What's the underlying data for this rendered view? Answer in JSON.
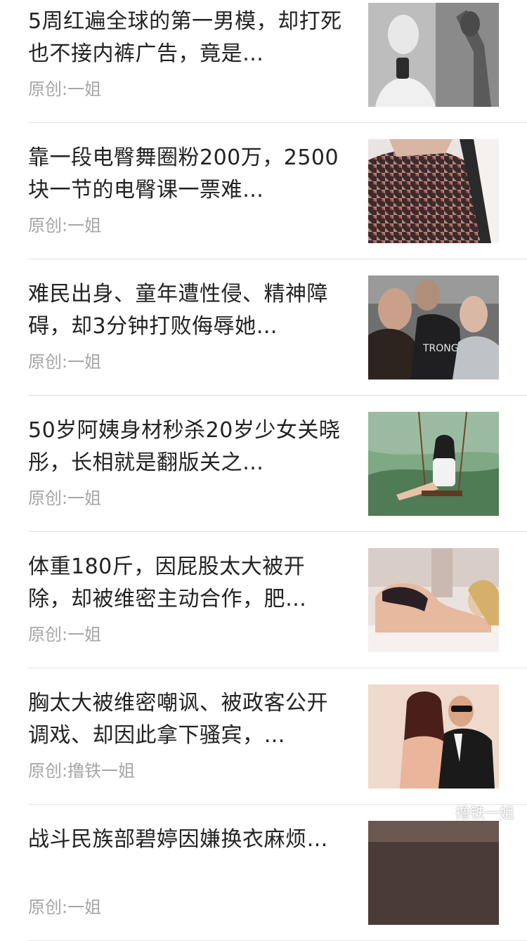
{
  "articles": [
    {
      "title": "5周红遍全球的第一男模，却打死也不接内裤广告，竟是…",
      "source": "原创:一姐",
      "image": "male-model-photo"
    },
    {
      "title": "靠一段电臀舞圈粉200万，2500块一节的电臀课一票难…",
      "source": "原创:一姐",
      "image": "dance-photo"
    },
    {
      "title": "难民出身、童年遭性侵、精神障碍，却3分钟打败侮辱她…",
      "source": "原创:一姐",
      "image": "fighters-faceoff-photo"
    },
    {
      "title": "50岁阿姨身材秒杀20岁少女关晓彤，长相就是翻版关之…",
      "source": "原创:一姐",
      "image": "swing-photo"
    },
    {
      "title": "体重180斤，因屁股太大被开除，却被维密主动合作，肥…",
      "source": "原创:一姐",
      "image": "lingerie-model-photo"
    },
    {
      "title": "胸太大被维密嘲讽、被政客公开调戏、却因此拿下骚宾，…",
      "source": "原创:撸铁一姐",
      "image": "couple-photo"
    },
    {
      "title": "战斗民族部碧婷因嫌换衣麻烦…",
      "source": "原创:一姐",
      "image": "partial-photo"
    }
  ],
  "watermark": {
    "text": "撸铁一姐",
    "icon": "wechat-icon"
  },
  "colors": {
    "title": "#222222",
    "source": "#a6a6a6",
    "divider": "#e3e3e3"
  }
}
